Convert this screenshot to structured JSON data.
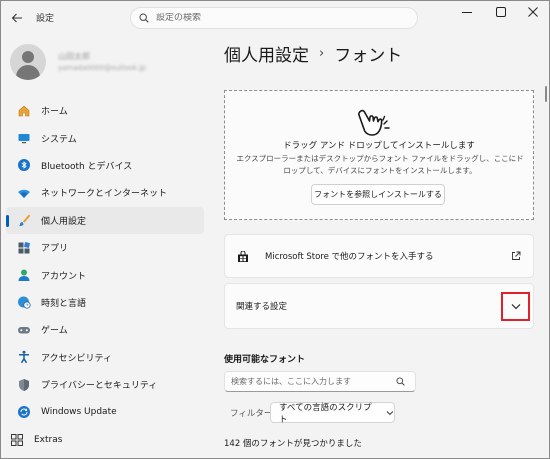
{
  "titlebar": {
    "app_title": "設定",
    "search_placeholder": "設定の検索"
  },
  "profile": {
    "name": "山田太郎",
    "email": "yamada0000@outlook.jp"
  },
  "sidebar": {
    "items": [
      {
        "label": "ホーム",
        "icon": "home-icon"
      },
      {
        "label": "システム",
        "icon": "system-icon"
      },
      {
        "label": "Bluetooth とデバイス",
        "icon": "bluetooth-icon"
      },
      {
        "label": "ネットワークとインターネット",
        "icon": "wifi-icon"
      },
      {
        "label": "個人用設定",
        "icon": "brush-icon",
        "active": true
      },
      {
        "label": "アプリ",
        "icon": "apps-icon"
      },
      {
        "label": "アカウント",
        "icon": "account-icon"
      },
      {
        "label": "時刻と言語",
        "icon": "globe-clock-icon"
      },
      {
        "label": "ゲーム",
        "icon": "gamepad-icon"
      },
      {
        "label": "アクセシビリティ",
        "icon": "accessibility-icon"
      },
      {
        "label": "プライバシーとセキュリティ",
        "icon": "shield-icon"
      },
      {
        "label": "Windows Update",
        "icon": "update-icon"
      }
    ],
    "extras_label": "Extras"
  },
  "main": {
    "breadcrumb_parent": "個人用設定",
    "breadcrumb_sep": "›",
    "page_title": "フォント",
    "drop_title": "ドラッグ アンド ドロップしてインストールします",
    "drop_desc": "エクスプローラーまたはデスクトップからフォント ファイルをドラッグし、ここにドロップして、デバイスにフォントをインストールします。",
    "browse_label": "フォントを参照しインストールする",
    "store_label": "Microsoft Store で他のフォントを入手する",
    "related_label": "関連する設定",
    "available_heading": "使用可能なフォント",
    "font_search_placeholder": "検索するには、ここに入力します",
    "filter_label": "フィルター:",
    "filter_value": "すべての言語のスクリプト",
    "font_count": "142 個のフォントが見つかりました"
  },
  "colors": {
    "accent": "#005fb8",
    "highlight_border": "#e0202a",
    "background": "#f3f3f3"
  }
}
